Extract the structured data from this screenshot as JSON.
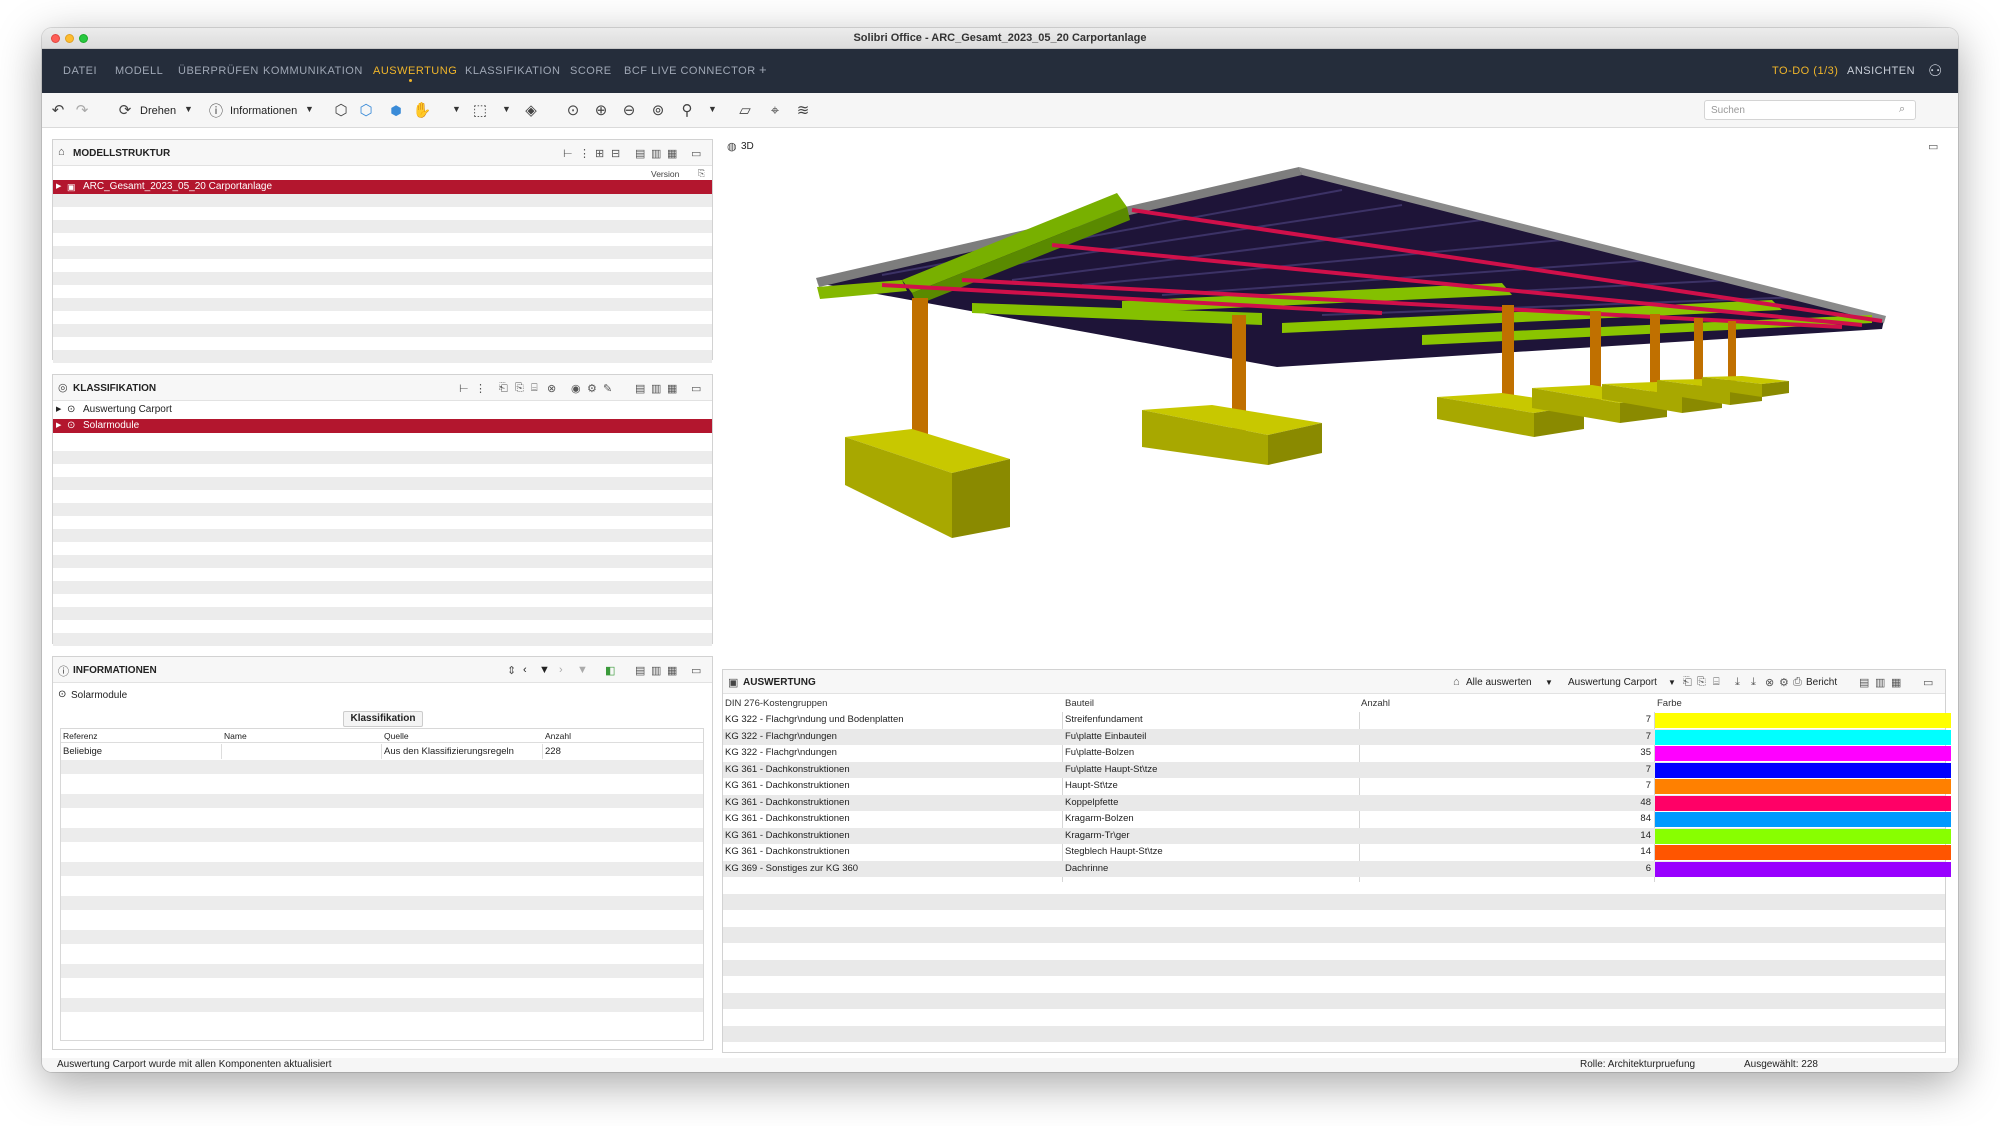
{
  "window": {
    "title": "Solibri Office - ARC_Gesamt_2023_05_20 Carportanlage"
  },
  "menu": {
    "items": [
      "DATEI",
      "MODELL",
      "ÜBERPRÜFEN",
      "KOMMUNIKATION",
      "AUSWERTUNG",
      "KLASSIFIKATION",
      "SCORE",
      "BCF LIVE CONNECTOR"
    ],
    "add": "+",
    "todo": "TO-DO (1/3)",
    "views": "ANSICHTEN",
    "active_color": "#f0b52a"
  },
  "toolbar": {
    "rotate_label": "Drehen",
    "info_label": "Informationen",
    "search_placeholder": "Suchen"
  },
  "model_structure": {
    "title": "MODELLSTRUKTUR",
    "version_header": "Version",
    "items": [
      {
        "label": "ARC_Gesamt_2023_05_20 Carportanlage",
        "selected": true
      }
    ]
  },
  "classification": {
    "title": "KLASSIFIKATION",
    "items": [
      {
        "label": "Auswertung Carport",
        "selected": false
      },
      {
        "label": "Solarmodule",
        "selected": true
      }
    ]
  },
  "information": {
    "title": "INFORMATIONEN",
    "subject": "Solarmodule",
    "tab": "Klassifikation",
    "headers": [
      "Referenz",
      "Name",
      "Quelle",
      "Anzahl"
    ],
    "rows": [
      [
        "Beliebige",
        "",
        "Aus den Klassifizierungsregeln",
        "228"
      ]
    ]
  },
  "viewport": {
    "title": "3D"
  },
  "evaluation": {
    "title": "AUSWERTUNG",
    "evaluate_all": "Alle auswerten",
    "preset": "Auswertung Carport",
    "report": "Bericht",
    "headers": [
      "DIN 276-Kostengruppen",
      "Bauteil",
      "Anzahl",
      "Farbe"
    ],
    "rows": [
      {
        "group": "KG 322 - Flachgr\\ndung und Bodenplatten",
        "part": "Streifenfundament",
        "count": "7",
        "color": "#ffff00"
      },
      {
        "group": "KG 322 - Flachgr\\ndungen",
        "part": "Fu\\platte Einbauteil",
        "count": "7",
        "color": "#00ffff"
      },
      {
        "group": "KG 322 - Flachgr\\ndungen",
        "part": "Fu\\platte-Bolzen",
        "count": "35",
        "color": "#ff00ff"
      },
      {
        "group": "KG 361 - Dachkonstruktionen",
        "part": "Fu\\platte Haupt-St\\tze",
        "count": "7",
        "color": "#0000ff"
      },
      {
        "group": "KG 361 - Dachkonstruktionen",
        "part": "Haupt-St\\tze",
        "count": "7",
        "color": "#ff8000"
      },
      {
        "group": "KG 361 - Dachkonstruktionen",
        "part": "Koppelpfette",
        "count": "48",
        "color": "#ff0066"
      },
      {
        "group": "KG 361 - Dachkonstruktionen",
        "part": "Kragarm-Bolzen",
        "count": "84",
        "color": "#0099ff"
      },
      {
        "group": "KG 361 - Dachkonstruktionen",
        "part": "Kragarm-Tr\\ger",
        "count": "14",
        "color": "#88ff00"
      },
      {
        "group": "KG 361 - Dachkonstruktionen",
        "part": "Stegblech Haupt-St\\tze",
        "count": "14",
        "color": "#ff5500"
      },
      {
        "group": "KG 369 - Sonstiges zur KG 360",
        "part": "Dachrinne",
        "count": "6",
        "color": "#9900ff"
      }
    ]
  },
  "status": {
    "message": "Auswertung Carport wurde mit allen Komponenten aktualisiert",
    "role": "Rolle: Architekturpruefung",
    "selected": "Ausgewählt: 228"
  }
}
